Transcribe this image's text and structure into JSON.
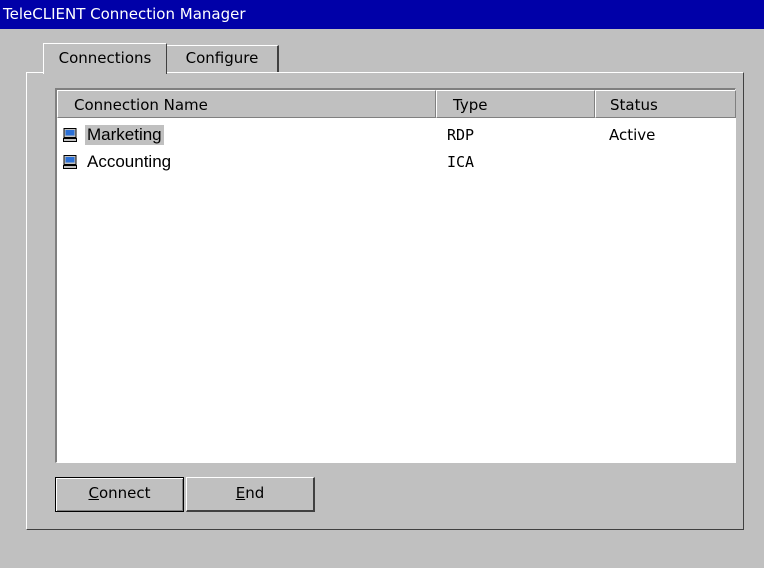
{
  "window": {
    "title": "TeleCLIENT Connection Manager"
  },
  "tabs": [
    {
      "label": "Connections",
      "active": true
    },
    {
      "label": "Configure",
      "active": false
    }
  ],
  "list": {
    "columns": [
      "Connection Name",
      "Type",
      "Status"
    ],
    "rows": [
      {
        "name": "Marketing",
        "type": "RDP",
        "status": "Active",
        "selected": true,
        "icon": "computer-icon"
      },
      {
        "name": "Accounting",
        "type": "ICA",
        "status": "",
        "selected": false,
        "icon": "computer-icon"
      }
    ]
  },
  "buttons": {
    "connect": {
      "accel": "C",
      "rest": "onnect"
    },
    "end": {
      "accel": "E",
      "rest": "nd"
    }
  },
  "colors": {
    "titlebar": "#0000a8",
    "face": "#c0c0c0",
    "icon_screen": "#2a6fd6"
  }
}
